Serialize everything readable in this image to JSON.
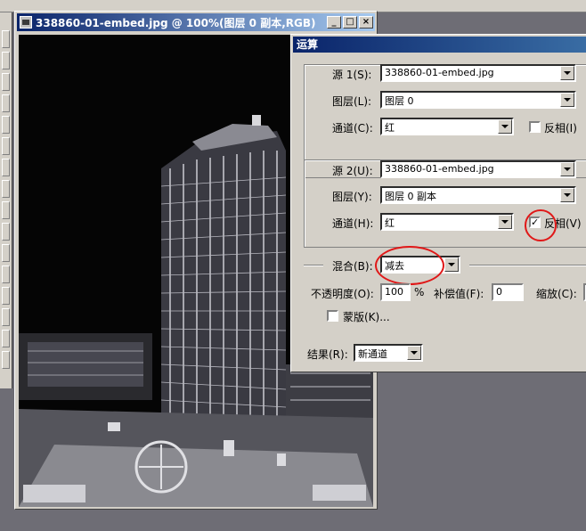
{
  "document": {
    "title": "338860-01-embed.jpg @ 100%(图层 0 副本,RGB)",
    "caption_buttons": [
      "_",
      "□",
      "×"
    ]
  },
  "dialog": {
    "title": "运算",
    "source1": {
      "label": "源 1(S):",
      "file": "338860-01-embed.jpg",
      "layer_label": "图层(L):",
      "layer": "图层 0",
      "channel_label": "通道(C):",
      "channel": "红",
      "invert_label": "反相(I)",
      "invert_checked": false
    },
    "source2": {
      "label": "源 2(U):",
      "file": "338860-01-embed.jpg",
      "layer_label": "图层(Y):",
      "layer": "图层 0 副本",
      "channel_label": "通道(H):",
      "channel": "红",
      "invert_label": "反相(V)",
      "invert_checked": true
    },
    "blend": {
      "label": "混合(B):",
      "mode": "减去",
      "opacity_label": "不透明度(O):",
      "opacity": "100",
      "percent": "%",
      "offset_label": "补偿值(F):",
      "offset": "0",
      "scale_label": "缩放(C):",
      "mask_label": "蒙版(K)..."
    },
    "result": {
      "label": "结果(R):",
      "value": "新通道"
    },
    "annotation_color": "#e01818"
  }
}
